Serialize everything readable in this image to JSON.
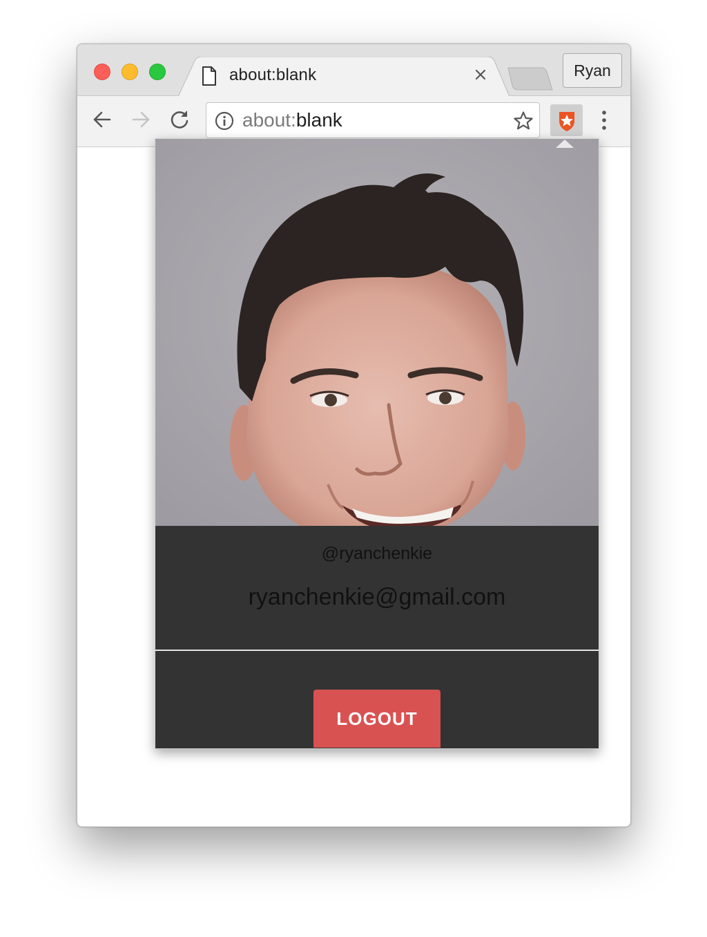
{
  "browser": {
    "tab_title": "about:blank",
    "profile_name": "Ryan",
    "url_scheme": "about:",
    "url_rest": "blank"
  },
  "popup": {
    "username": "@ryanchenkie",
    "email": "ryanchenkie@gmail.com",
    "logout_label": "LOGOUT"
  },
  "icons": {
    "traffic_lights": [
      "close-button",
      "minimize-button",
      "maximize-button"
    ],
    "tab": [
      "page-icon",
      "close-icon"
    ],
    "toolbar": [
      "back-arrow-icon",
      "forward-arrow-icon",
      "reload-icon",
      "info-icon",
      "star-icon",
      "auth0-extension-icon",
      "menu-dots-icon"
    ]
  },
  "colors": {
    "popup_background": "#333333",
    "logout_button": "#d95252",
    "extension_accent": "#eb5424",
    "avatar_background": "#a8a6ab"
  }
}
